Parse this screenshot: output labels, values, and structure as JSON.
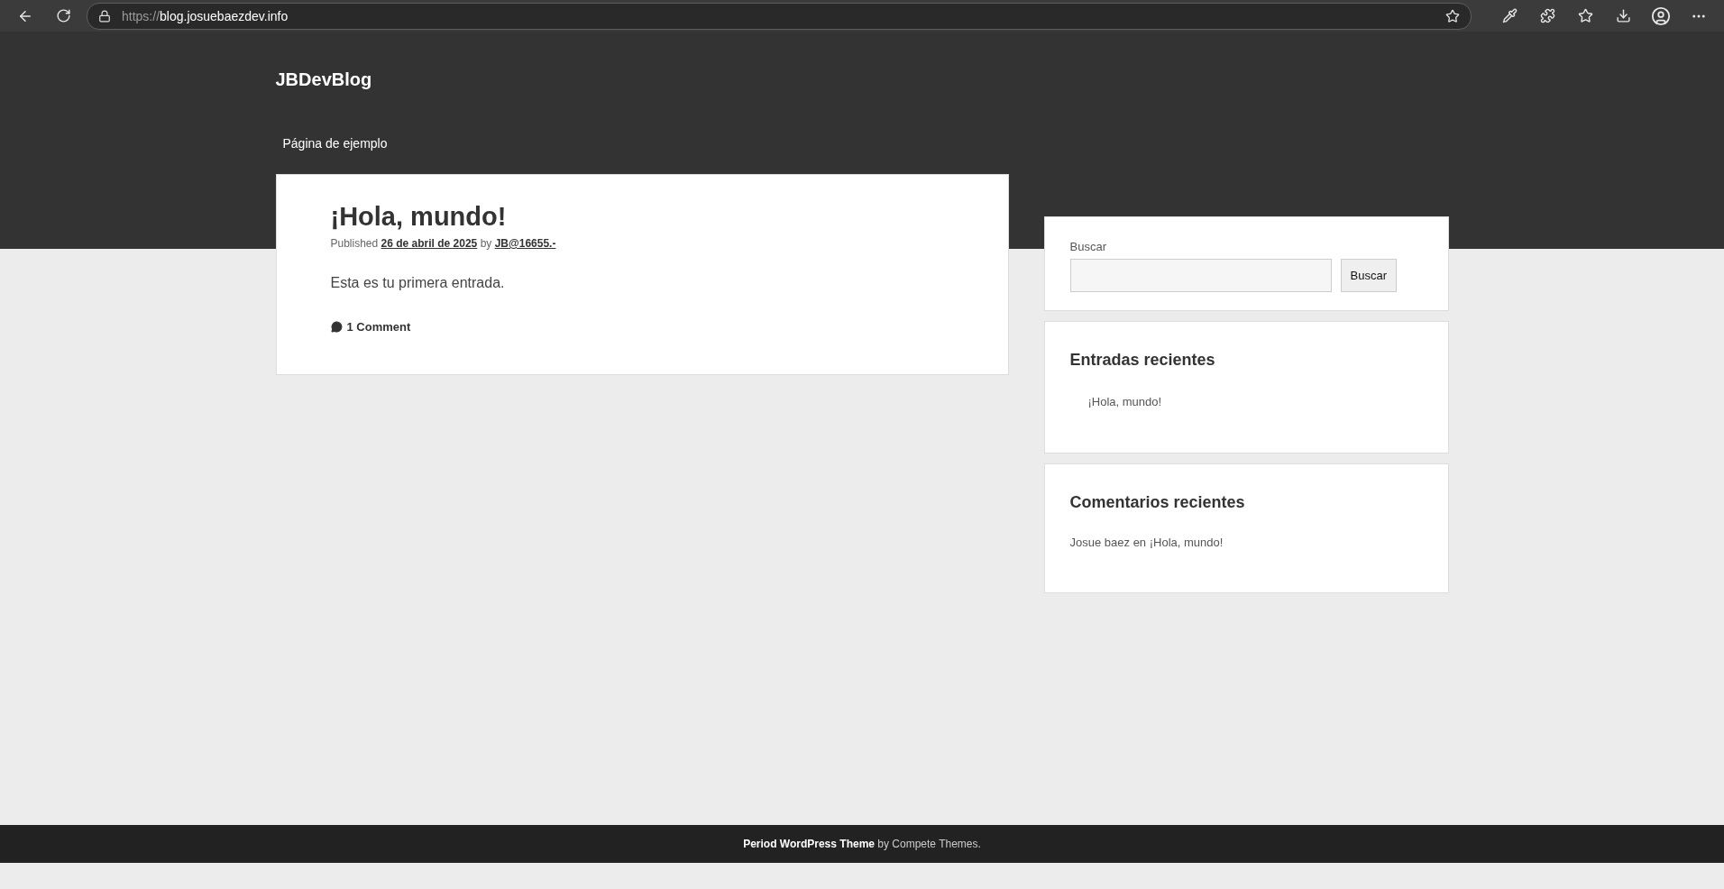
{
  "browser": {
    "url_scheme": "https://",
    "url_host": "blog.josuebaezdev.info"
  },
  "site": {
    "title": "JBDevBlog",
    "nav": [
      {
        "label": "Página de ejemplo"
      }
    ]
  },
  "post": {
    "title": "¡Hola, mundo!",
    "meta": {
      "published_label": "Published",
      "date": "26 de abril de 2025",
      "by_label": "by",
      "author": "JB@16655.-"
    },
    "body": "Esta es tu primera entrada.",
    "comments": "1 Comment"
  },
  "sidebar": {
    "search": {
      "label": "Buscar",
      "button": "Buscar"
    },
    "recent_posts": {
      "title": "Entradas recientes",
      "items": [
        "¡Hola, mundo!"
      ]
    },
    "recent_comments": {
      "title": "Comentarios recientes",
      "items": [
        {
          "author": "Josue baez",
          "joiner": "en",
          "post": "¡Hola, mundo!"
        }
      ]
    }
  },
  "footer": {
    "link": "Period WordPress Theme",
    "text": "by Compete Themes."
  }
}
